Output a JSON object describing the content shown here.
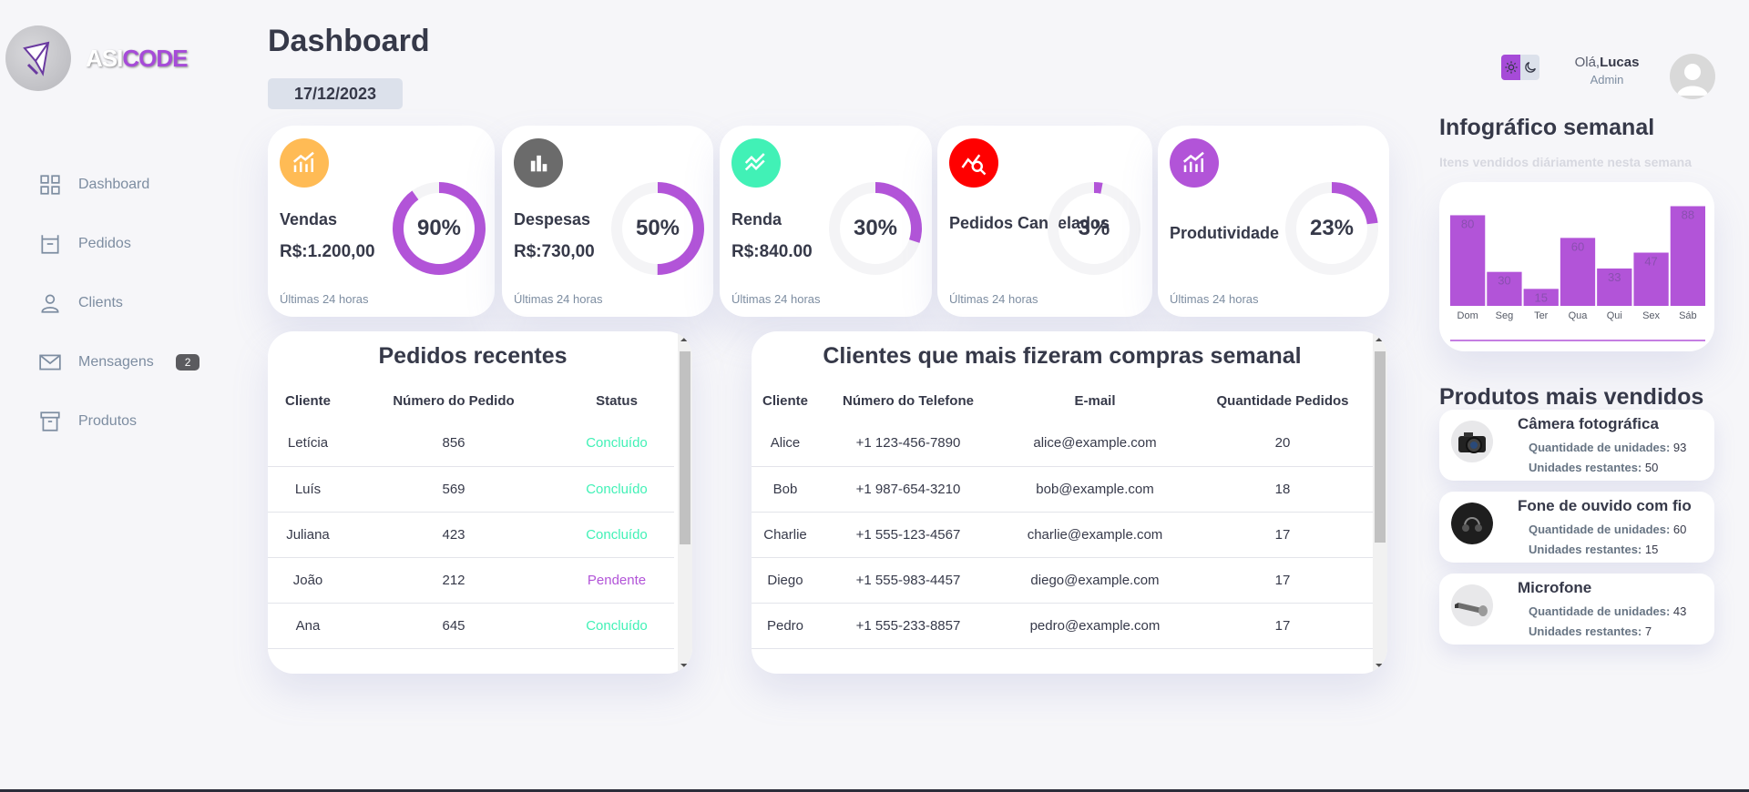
{
  "brand": {
    "name_part1": "ASI",
    "name_part2": "CODE"
  },
  "sidebar": {
    "items": [
      {
        "label": "Dashboard",
        "icon": "grid-icon"
      },
      {
        "label": "Pedidos",
        "icon": "basket-icon"
      },
      {
        "label": "Clients",
        "icon": "person-icon"
      },
      {
        "label": "Mensagens",
        "icon": "mail-icon",
        "badge": "2"
      },
      {
        "label": "Produtos",
        "icon": "archive-icon"
      }
    ]
  },
  "header": {
    "title": "Dashboard",
    "date": "17/12/2023",
    "greeting": "Olá,",
    "user_name": "Lucas",
    "role": "Admin"
  },
  "cards": [
    {
      "label": "Vendas",
      "value": "R$:1.200,00",
      "percent_text": "90%",
      "percent": 90,
      "footer": "Últimas 24 horas",
      "icon": "chart-up-icon",
      "icon_color": "#ffbb55"
    },
    {
      "label": "Despesas",
      "value": "R$:730,00",
      "percent_text": "50%",
      "percent": 50,
      "footer": "Últimas 24 horas",
      "icon": "bar-chart-icon",
      "icon_color": "#6b6b6b"
    },
    {
      "label": "Renda",
      "value": "R$:840.00",
      "percent_text": "30%",
      "percent": 30,
      "footer": "Últimas 24 horas",
      "icon": "trend-icon",
      "icon_color": "#41f1b6"
    },
    {
      "label": "Pedidos Cancelados",
      "value": "",
      "percent_text": "3%",
      "percent": 3,
      "footer": "Últimas 24 horas",
      "icon": "search-chart-icon",
      "icon_color": "#ff0000"
    },
    {
      "label": "Produtividade",
      "value": "",
      "percent_text": "23%",
      "percent": 23,
      "footer": "Últimas 24 horas",
      "icon": "chart-up-icon",
      "icon_color": "#b254d8"
    }
  ],
  "recent_orders": {
    "title": "Pedidos recentes",
    "columns": [
      "Cliente",
      "Número do Pedido",
      "Status"
    ],
    "rows": [
      {
        "client": "Letícia",
        "order": "856",
        "status": "Concluído",
        "state": "ok"
      },
      {
        "client": "Luís",
        "order": "569",
        "status": "Concluído",
        "state": "ok"
      },
      {
        "client": "Juliana",
        "order": "423",
        "status": "Concluído",
        "state": "ok"
      },
      {
        "client": "João",
        "order": "212",
        "status": "Pendente",
        "state": "pend"
      },
      {
        "client": "Ana",
        "order": "645",
        "status": "Concluído",
        "state": "ok"
      }
    ]
  },
  "top_clients": {
    "title": "Clientes que mais fizeram compras semanal",
    "columns": [
      "Cliente",
      "Número do Telefone",
      "E-mail",
      "Quantidade Pedidos"
    ],
    "rows": [
      {
        "client": "Alice",
        "phone": "+1 123-456-7890",
        "email": "alice@example.com",
        "qty": "20"
      },
      {
        "client": "Bob",
        "phone": "+1 987-654-3210",
        "email": "bob@example.com",
        "qty": "18"
      },
      {
        "client": "Charlie",
        "phone": "+1 555-123-4567",
        "email": "charlie@example.com",
        "qty": "17"
      },
      {
        "client": "Diego",
        "phone": "+1 555-983-4457",
        "email": "diego@example.com",
        "qty": "17"
      },
      {
        "client": "Pedro",
        "phone": "+1 555-233-8857",
        "email": "pedro@example.com",
        "qty": "17"
      }
    ]
  },
  "infographic": {
    "title": "Infográfico semanal",
    "subtitle": "Itens vendidos diáriamente nesta semana"
  },
  "chart_data": {
    "type": "bar",
    "categories": [
      "Dom",
      "Seg",
      "Ter",
      "Qua",
      "Qui",
      "Sex",
      "Sáb"
    ],
    "values": [
      80,
      30,
      15,
      60,
      33,
      47,
      88
    ],
    "color": "#b254d8",
    "ylim": [
      0,
      90
    ]
  },
  "products": {
    "title": "Produtos mais vendidos",
    "qty_label": "Quantidade de unidades:",
    "rest_label": "Unidades restantes:",
    "items": [
      {
        "name": "Câmera fotográfica",
        "qty": "93",
        "rest": "50",
        "icon": "camera-icon"
      },
      {
        "name": "Fone de ouvido com fio",
        "qty": "60",
        "rest": "15",
        "icon": "headphones-icon"
      },
      {
        "name": "Microfone",
        "qty": "43",
        "rest": "7",
        "icon": "microphone-icon"
      }
    ]
  }
}
